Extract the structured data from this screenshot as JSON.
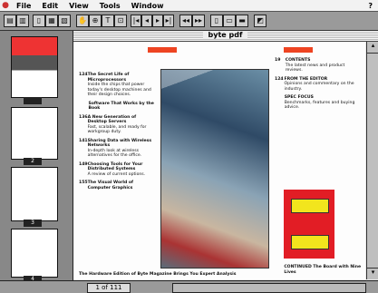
{
  "menubar": {
    "items": [
      "File",
      "Edit",
      "View",
      "Tools",
      "Window"
    ]
  },
  "window": {
    "title": "byte pdf"
  },
  "thumbnails": [
    {
      "page": ""
    },
    {
      "page": "2"
    },
    {
      "page": "3"
    },
    {
      "page": "4"
    }
  ],
  "status": {
    "page": "1 of 111"
  },
  "document": {
    "left_entries": [
      {
        "num": "124",
        "title": "The Secret Life of Microprocessors",
        "body": "Inside the chips that power today's desktop machines and their design choices."
      },
      {
        "num": "",
        "title": "Software That Works by the Book",
        "body": ""
      },
      {
        "num": "136",
        "title": "A New Generation of Desktop Servers",
        "body": "Fast, scalable, and ready for workgroup duty."
      },
      {
        "num": "141",
        "title": "Sharing Data with Wireless Networks",
        "body": "In-depth look at wireless alternatives for the office."
      },
      {
        "num": "149",
        "title": "Choosing Tools for Your Distributed Systems",
        "body": "A review of current options."
      },
      {
        "num": "155",
        "title": "The Visual World of Computer Graphics",
        "body": ""
      }
    ],
    "right_entries": [
      {
        "num": "19",
        "title": "CONTENTS",
        "body": "The latest news and product reviews."
      },
      {
        "num": "124",
        "title": "FROM THE EDITOR",
        "body": "Opinions and commentary on the industry."
      },
      {
        "num": "",
        "title": "SPEC FOCUS",
        "body": "Benchmarks, features and buying advice."
      },
      {
        "num": "",
        "title": "CONTINUED The Board with Nine Lives",
        "body": ""
      }
    ],
    "footer_line": "The Hardware Edition of Byte Magazine Brings You Expert Analysis"
  }
}
